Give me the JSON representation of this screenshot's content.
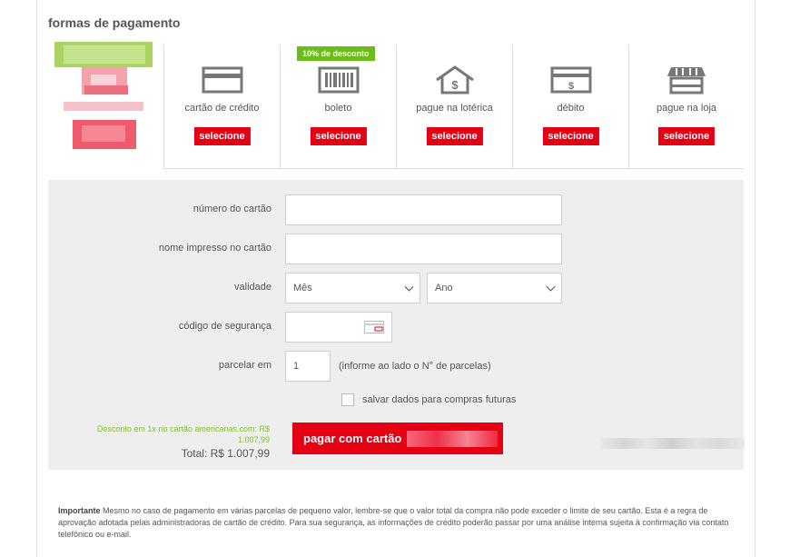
{
  "page": {
    "title": "formas de pagamento"
  },
  "payment_methods": {
    "discount_badge": "10% de desconto",
    "select_label": "selecione",
    "items": [
      {
        "label": "cartão de crédito",
        "icon": "credit-card-icon"
      },
      {
        "label": "boleto",
        "icon": "barcode-icon"
      },
      {
        "label": "pague na lotérica",
        "icon": "lottery-house-icon"
      },
      {
        "label": "débito",
        "icon": "debit-card-icon"
      },
      {
        "label": "pague na loja",
        "icon": "store-icon"
      }
    ]
  },
  "form": {
    "card_number_label": "número do cartão",
    "card_name_label": "nome impresso no cartão",
    "validity_label": "validade",
    "month_value": "Mês",
    "year_value": "Ano",
    "security_code_label": "código de segurança",
    "installments_label": "parcelar em",
    "installments_value": "1",
    "installments_hint": "(informe ao lado o N° de parcelas)",
    "save_data_label": "salvar dados para compras futuras",
    "discount_text": "Desconto em 1x no cartão americanas.com: R$ 1.007,99",
    "total_text": "Total: R$ 1.007,99",
    "pay_button_label": "pagar com cartão"
  },
  "notice": {
    "strong": "Importante",
    "text": " Mesmo no caso de pagamento em várias parcelas de pequeno valor, lembre-se que o valor total da compra não pode exceder o limite de seu cartão. Esta é a regra de aprovação adotada pelas administradoras de cartão de crédito. Para sua segurança, as informações de crédito poderão passar por uma análise interna sujeita à confirmação via contato telefônico ou e-mail."
  },
  "colors": {
    "accent_red": "#e60014",
    "discount_green": "#6bbd1a",
    "panel_gray": "#eeeeee"
  }
}
